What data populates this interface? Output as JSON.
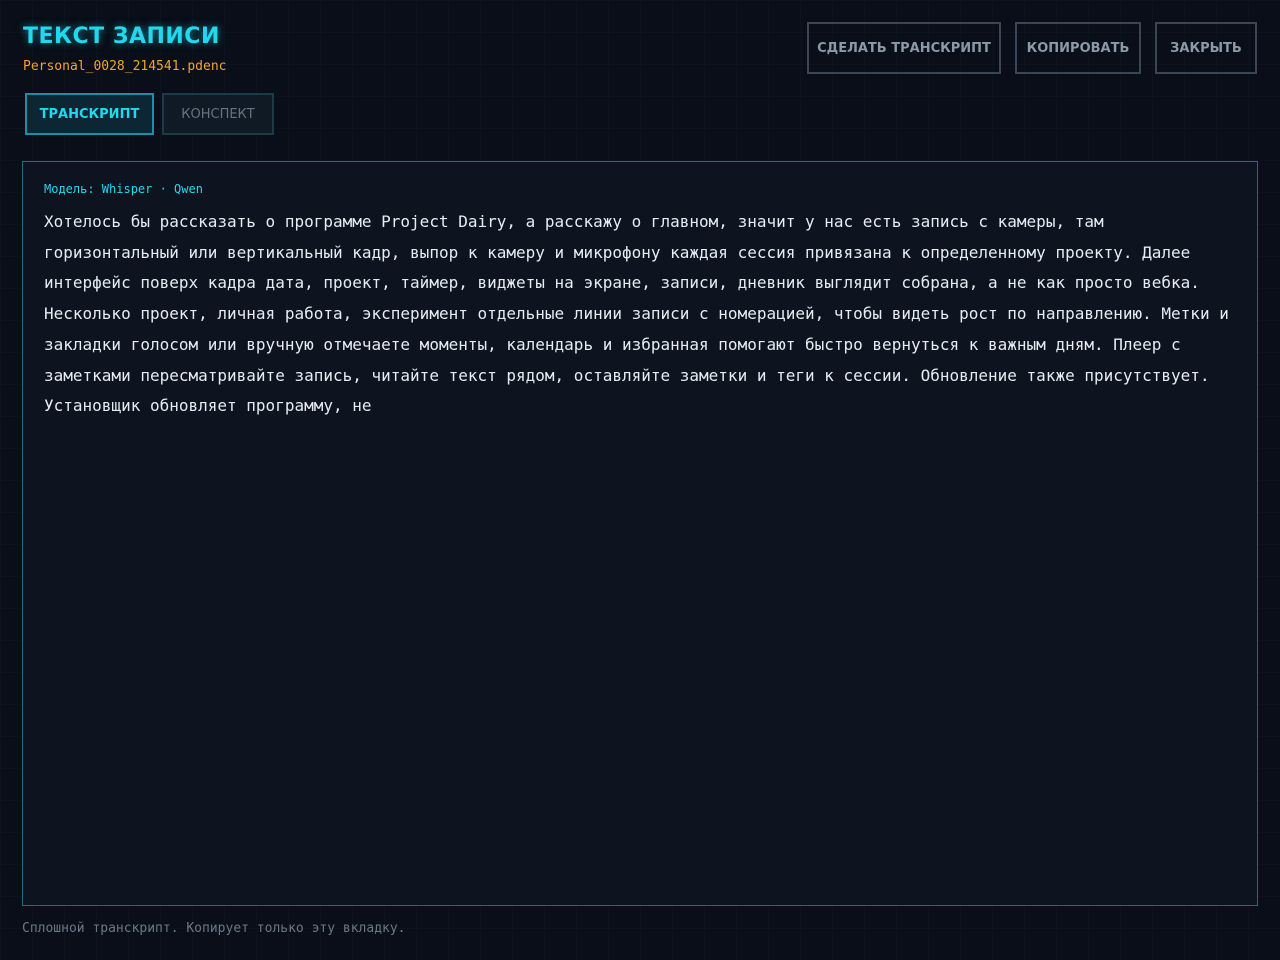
{
  "header": {
    "title": "ТЕКСТ ЗАПИСИ",
    "filename": "Personal_0028_214541.pdenc"
  },
  "toolbar": {
    "transcribe_label": "СДЕЛАТЬ ТРАНСКРИПТ",
    "copy_label": "КОПИРОВАТЬ",
    "close_label": "ЗАКРЫТЬ"
  },
  "tabs": [
    {
      "label": "ТРАНСКРИПТ",
      "active": true
    },
    {
      "label": "КОНСПЕКТ",
      "active": false
    }
  ],
  "transcript": {
    "model": "Модель: Whisper · Qwen",
    "text": "Хотелось бы рассказать о программе Project Dairy, а расскажу о главном, значит у нас есть запись с камеры, там горизонтальный или вертикальный кадр, выпор к камеру и микрофону каждая сессия привязана к определенному проекту. Далее интерфейс поверх кадра дата, проект, таймер, виджеты на экране, записи, дневник выглядит собрана, а не как просто вебка. Несколько проект, личная работа, эксперимент отдельные линии записи с номерацией, чтобы видеть рост по направлению. Метки и закладки голосом или вручную отмечаете моменты, календарь и избранная помогают быстро вернуться к важным дням. Плеер с заметками пересматривайте запись, читайте текст рядом, оставляйте заметки и теги к сессии. Обновление также присутствует. Установщик обновляет программу, не"
  },
  "footer": {
    "hint": "Сплошной транскрипт. Копирует только эту вкладку."
  },
  "colors": {
    "accent": "#22d8ee",
    "filename": "#f0a62a",
    "background": "#090e18",
    "panel": "#0e141f"
  }
}
